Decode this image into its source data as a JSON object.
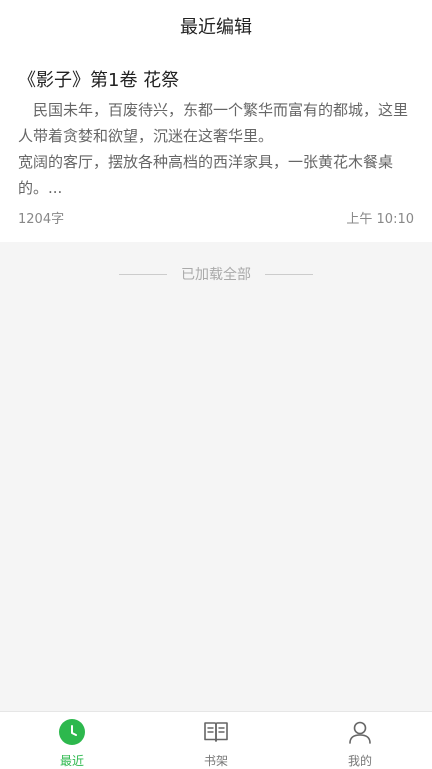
{
  "header": {
    "title": "最近编辑"
  },
  "card": {
    "title": "《影子》第1卷 花祭",
    "excerpt": "　民国未年，百废待兴，东都一个繁华而富有的都城，这里人带着贪婪和欲望，沉迷在这奢华里。\n宽阔的客厅，摆放各种高档的西洋家具，一张黄花木餐桌的。...",
    "word_count": "1204字",
    "time": "上午  10:10"
  },
  "list_footer": {
    "text": "已加载全部"
  },
  "tabbar": {
    "tabs": [
      {
        "label": "最近",
        "icon": "clock-icon",
        "active": true
      },
      {
        "label": "书架",
        "icon": "open-book-icon",
        "active": false
      },
      {
        "label": "我的",
        "icon": "person-icon",
        "active": false
      }
    ]
  },
  "colors": {
    "accent": "#2db84d",
    "background": "#f5f5f5",
    "card": "#ffffff",
    "text_primary": "#222222",
    "text_secondary": "#666666",
    "text_muted": "#888888"
  }
}
